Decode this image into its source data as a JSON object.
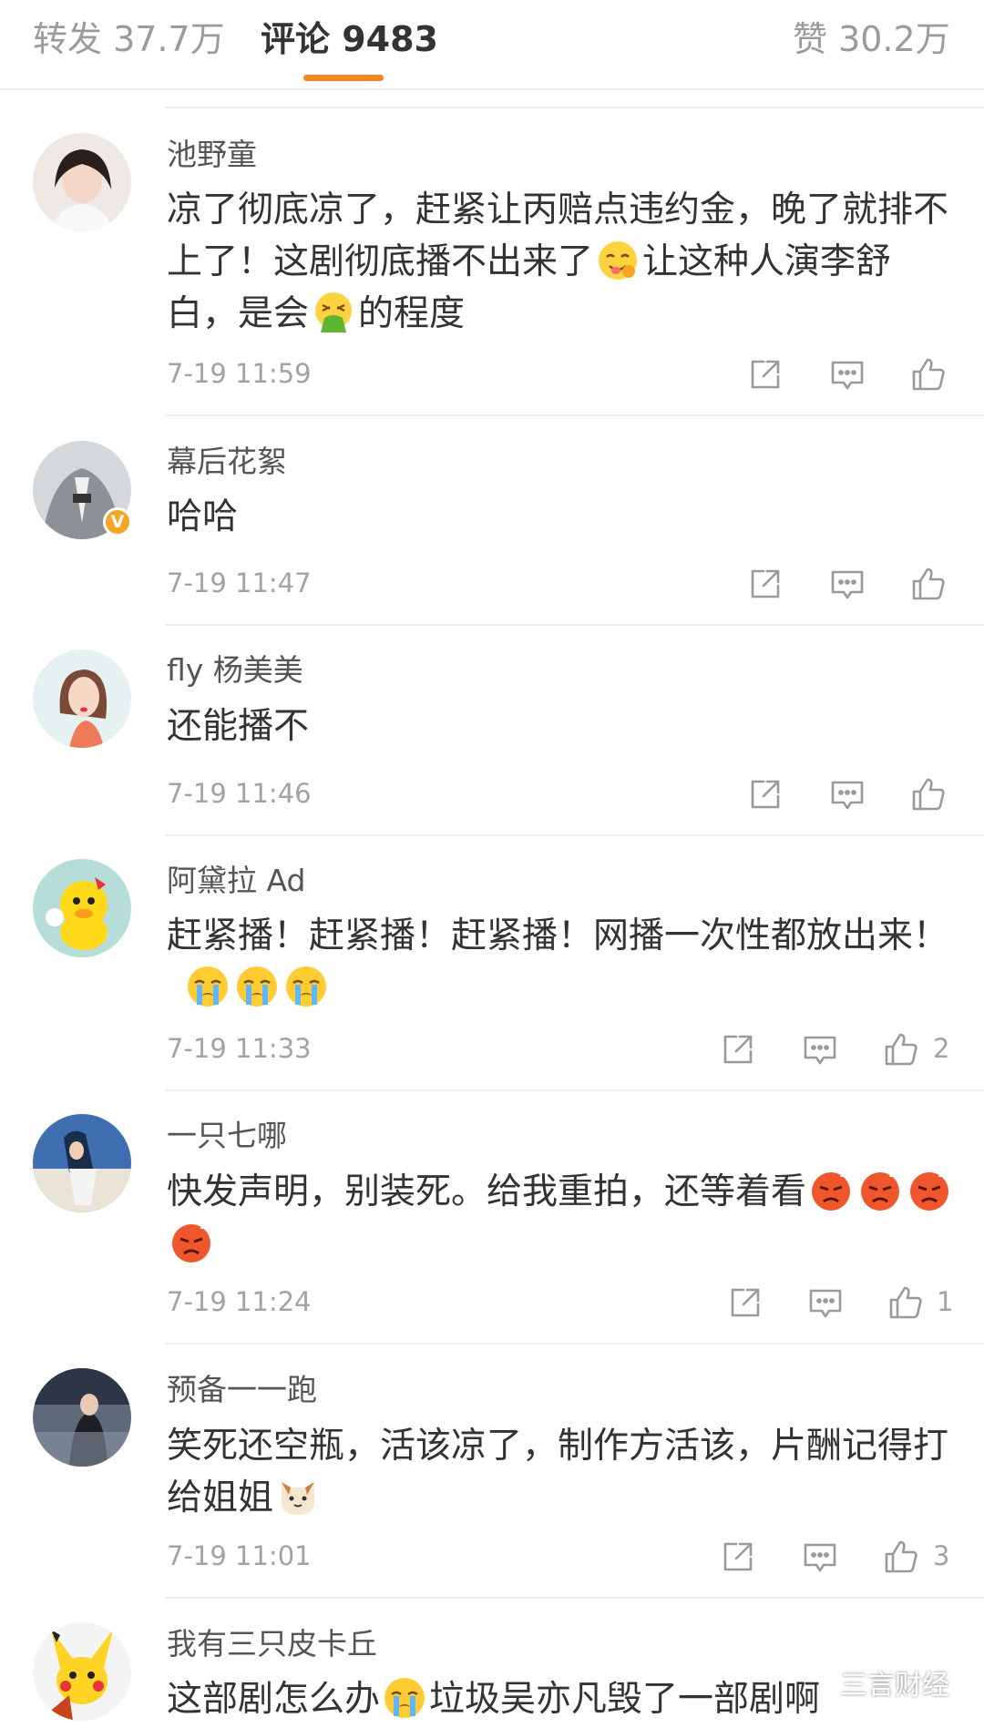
{
  "tabs": [
    {
      "label": "转发 37.7万",
      "active": false
    },
    {
      "label": "评论 9483",
      "active": true
    },
    {
      "label": "赞 30.2万",
      "active": false
    }
  ],
  "comments": [
    {
      "user": "池野童",
      "text_parts": [
        "凉了彻底凉了，赶紧让丙赔点违约金，晚了就排不上了！这剧彻底播不出来了",
        "让这种人演李舒白，是会",
        "的程度"
      ],
      "emojis": [
        "yummy-face-emoji",
        "vomiting-face-emoji"
      ],
      "time": "7-19 11:59",
      "likes": ""
    },
    {
      "user": "幕后花絮",
      "text": "哈哈",
      "verified": true,
      "time": "7-19 11:47",
      "likes": ""
    },
    {
      "user": "fly 杨美美",
      "text": "还能播不",
      "time": "7-19 11:46",
      "likes": ""
    },
    {
      "user": "阿黛拉 Ad",
      "text": "赶紧播！赶紧播！赶紧播！网播一次性都放出来！",
      "emojis": [
        "crying-face-emoji",
        "crying-face-emoji",
        "crying-face-emoji"
      ],
      "time": "7-19 11:33",
      "likes": "2"
    },
    {
      "user": "一只七哪",
      "text": "快发声明，别装死。给我重拍，还等着看",
      "emojis": [
        "angry-face-emoji",
        "angry-face-emoji",
        "angry-face-emoji",
        "angry-face-emoji"
      ],
      "time": "7-19 11:24",
      "likes": "1"
    },
    {
      "user": "预备一一跑",
      "text": "笑死还空瓶，活该凉了，制作方活该，片酬记得打给姐姐",
      "emojis": [
        "cat-face-emoji"
      ],
      "time": "7-19 11:01",
      "likes": "3"
    },
    {
      "user": "我有三只皮卡丘",
      "text_parts": [
        "这部剧怎么办",
        "垃圾吴亦凡毁了一部剧啊"
      ],
      "emojis": [
        "crying-face-emoji"
      ]
    }
  ],
  "watermark": "三言财经",
  "colors": {
    "accent": "#f5861f",
    "text": "#333333",
    "muted": "#a3a3a3",
    "divider": "#ececec",
    "verified": "#f6a623"
  }
}
